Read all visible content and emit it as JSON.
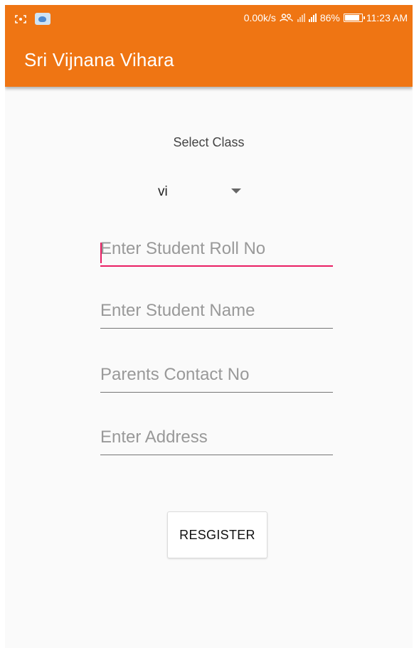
{
  "status_bar": {
    "network_speed": "0.00k/s",
    "battery_percent": "86%",
    "battery_level": 0.86,
    "time": "11:23 AM",
    "left_icons": [
      "screenshot-icon",
      "weather-icon"
    ],
    "right_icons": [
      "people-icon",
      "signal-icon",
      "signal-icon",
      "battery-icon"
    ]
  },
  "app_bar": {
    "title": "Sri Vijnana Vihara",
    "color": "#ef7513"
  },
  "form": {
    "select_label": "Select Class",
    "class_value": "vi",
    "dropdown_icon": "chevron-down-icon",
    "roll_no_placeholder": "Enter Student Roll No",
    "name_placeholder": "Enter Student Name",
    "contact_placeholder": "Parents Contact No",
    "address_placeholder": "Enter Address",
    "register_label": "RESGISTER",
    "focus_color": "#e91e63"
  }
}
